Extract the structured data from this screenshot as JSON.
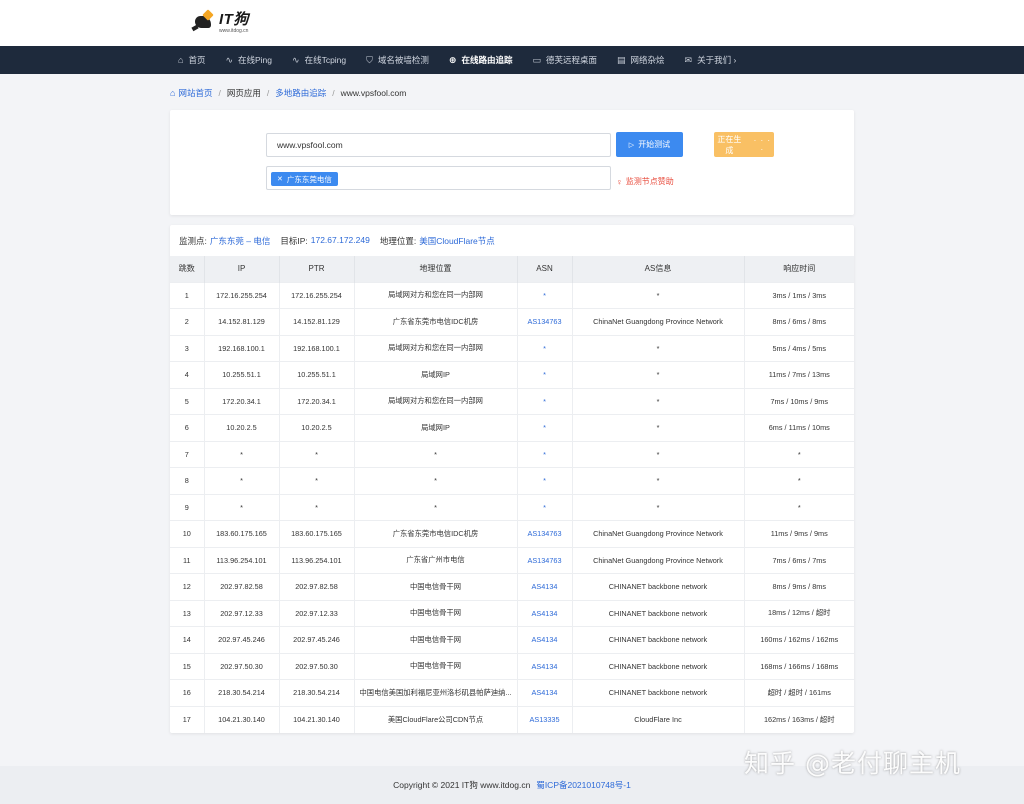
{
  "brand": {
    "name": "IT狗",
    "domain": "www.itdog.cn"
  },
  "nav": [
    {
      "icon": "⌂",
      "label": "首页"
    },
    {
      "icon": "∿",
      "label": "在线Ping"
    },
    {
      "icon": "∿",
      "label": "在线Tcping"
    },
    {
      "icon": "⛉",
      "label": "域名被墙检测"
    },
    {
      "icon": "⊕",
      "label": "在线路由追踪",
      "active": true
    },
    {
      "icon": "▭",
      "label": "德芙远程桌面"
    },
    {
      "icon": "▤",
      "label": "网络杂烩"
    },
    {
      "icon": "✉",
      "label": "关于我们 ›"
    }
  ],
  "breadcrumb": {
    "home": "网站首页",
    "app": "网页应用",
    "tool": "多地路由追踪",
    "current": "www.vpsfool.com"
  },
  "form": {
    "host_value": "www.vpsfool.com",
    "start_label": "开始测试",
    "generate_label": "正在生成",
    "generate_dots": "· · · ·",
    "node_tag": "广东东莞电信",
    "sponsor_label": "监测节点赞助"
  },
  "info": {
    "monitor_label": "监测点:",
    "monitor_value": "广东东莞 – 电信",
    "ip_label": "目标IP:",
    "ip_value": "172.67.172.249",
    "geo_label": "地理位置:",
    "geo_value": "美国CloudFlare节点"
  },
  "table": {
    "headers": [
      "跳数",
      "IP",
      "PTR",
      "地理位置",
      "ASN",
      "AS信息",
      "响应时间"
    ],
    "rows": [
      [
        "1",
        "172.16.255.254",
        "172.16.255.254",
        "局域网对方和您在同一内部网",
        "*",
        "*",
        "3ms / 1ms / 3ms"
      ],
      [
        "2",
        "14.152.81.129",
        "14.152.81.129",
        "广东省东莞市电信IDC机房",
        "AS134763",
        "ChinaNet Guangdong Province Network",
        "8ms / 6ms / 8ms"
      ],
      [
        "3",
        "192.168.100.1",
        "192.168.100.1",
        "局域网对方和您在同一内部网",
        "*",
        "*",
        "5ms / 4ms / 5ms"
      ],
      [
        "4",
        "10.255.51.1",
        "10.255.51.1",
        "局域网IP",
        "*",
        "*",
        "11ms / 7ms / 13ms"
      ],
      [
        "5",
        "172.20.34.1",
        "172.20.34.1",
        "局域网对方和您在同一内部网",
        "*",
        "*",
        "7ms / 10ms / 9ms"
      ],
      [
        "6",
        "10.20.2.5",
        "10.20.2.5",
        "局域网IP",
        "*",
        "*",
        "6ms / 11ms / 10ms"
      ],
      [
        "7",
        "*",
        "*",
        "*",
        "*",
        "*",
        "*"
      ],
      [
        "8",
        "*",
        "*",
        "*",
        "*",
        "*",
        "*"
      ],
      [
        "9",
        "*",
        "*",
        "*",
        "*",
        "*",
        "*"
      ],
      [
        "10",
        "183.60.175.165",
        "183.60.175.165",
        "广东省东莞市电信IDC机房",
        "AS134763",
        "ChinaNet Guangdong Province Network",
        "11ms / 9ms / 9ms"
      ],
      [
        "11",
        "113.96.254.101",
        "113.96.254.101",
        "广东省广州市电信",
        "AS134763",
        "ChinaNet Guangdong Province Network",
        "7ms / 6ms / 7ms"
      ],
      [
        "12",
        "202.97.82.58",
        "202.97.82.58",
        "中国电信骨干网",
        "AS4134",
        "CHINANET backbone network",
        "8ms / 9ms / 8ms"
      ],
      [
        "13",
        "202.97.12.33",
        "202.97.12.33",
        "中国电信骨干网",
        "AS4134",
        "CHINANET backbone network",
        "18ms / 12ms / 超时"
      ],
      [
        "14",
        "202.97.45.246",
        "202.97.45.246",
        "中国电信骨干网",
        "AS4134",
        "CHINANET backbone network",
        "160ms / 162ms / 162ms"
      ],
      [
        "15",
        "202.97.50.30",
        "202.97.50.30",
        "中国电信骨干网",
        "AS4134",
        "CHINANET backbone network",
        "168ms / 166ms / 168ms"
      ],
      [
        "16",
        "218.30.54.214",
        "218.30.54.214",
        "中国电信美国加利福尼亚州洛杉矶县帕萨迪纳...",
        "AS4134",
        "CHINANET backbone network",
        "超时 / 超时 / 161ms"
      ],
      [
        "17",
        "104.21.30.140",
        "104.21.30.140",
        "美国CloudFlare公司CDN节点",
        "AS13335",
        "CloudFlare Inc",
        "162ms / 163ms / 超时"
      ]
    ]
  },
  "footer": {
    "copyright": "Copyright © 2021 IT狗 www.itdog.cn",
    "icp": "蜀ICP备2021010748号-1"
  },
  "watermark": "知乎 @老付聊主机",
  "colors": {
    "nav_bg": "#1e2a3c",
    "primary": "#3c8af0",
    "warning": "#f9c064",
    "link": "#2d6ad8",
    "danger": "#e84c3d"
  }
}
